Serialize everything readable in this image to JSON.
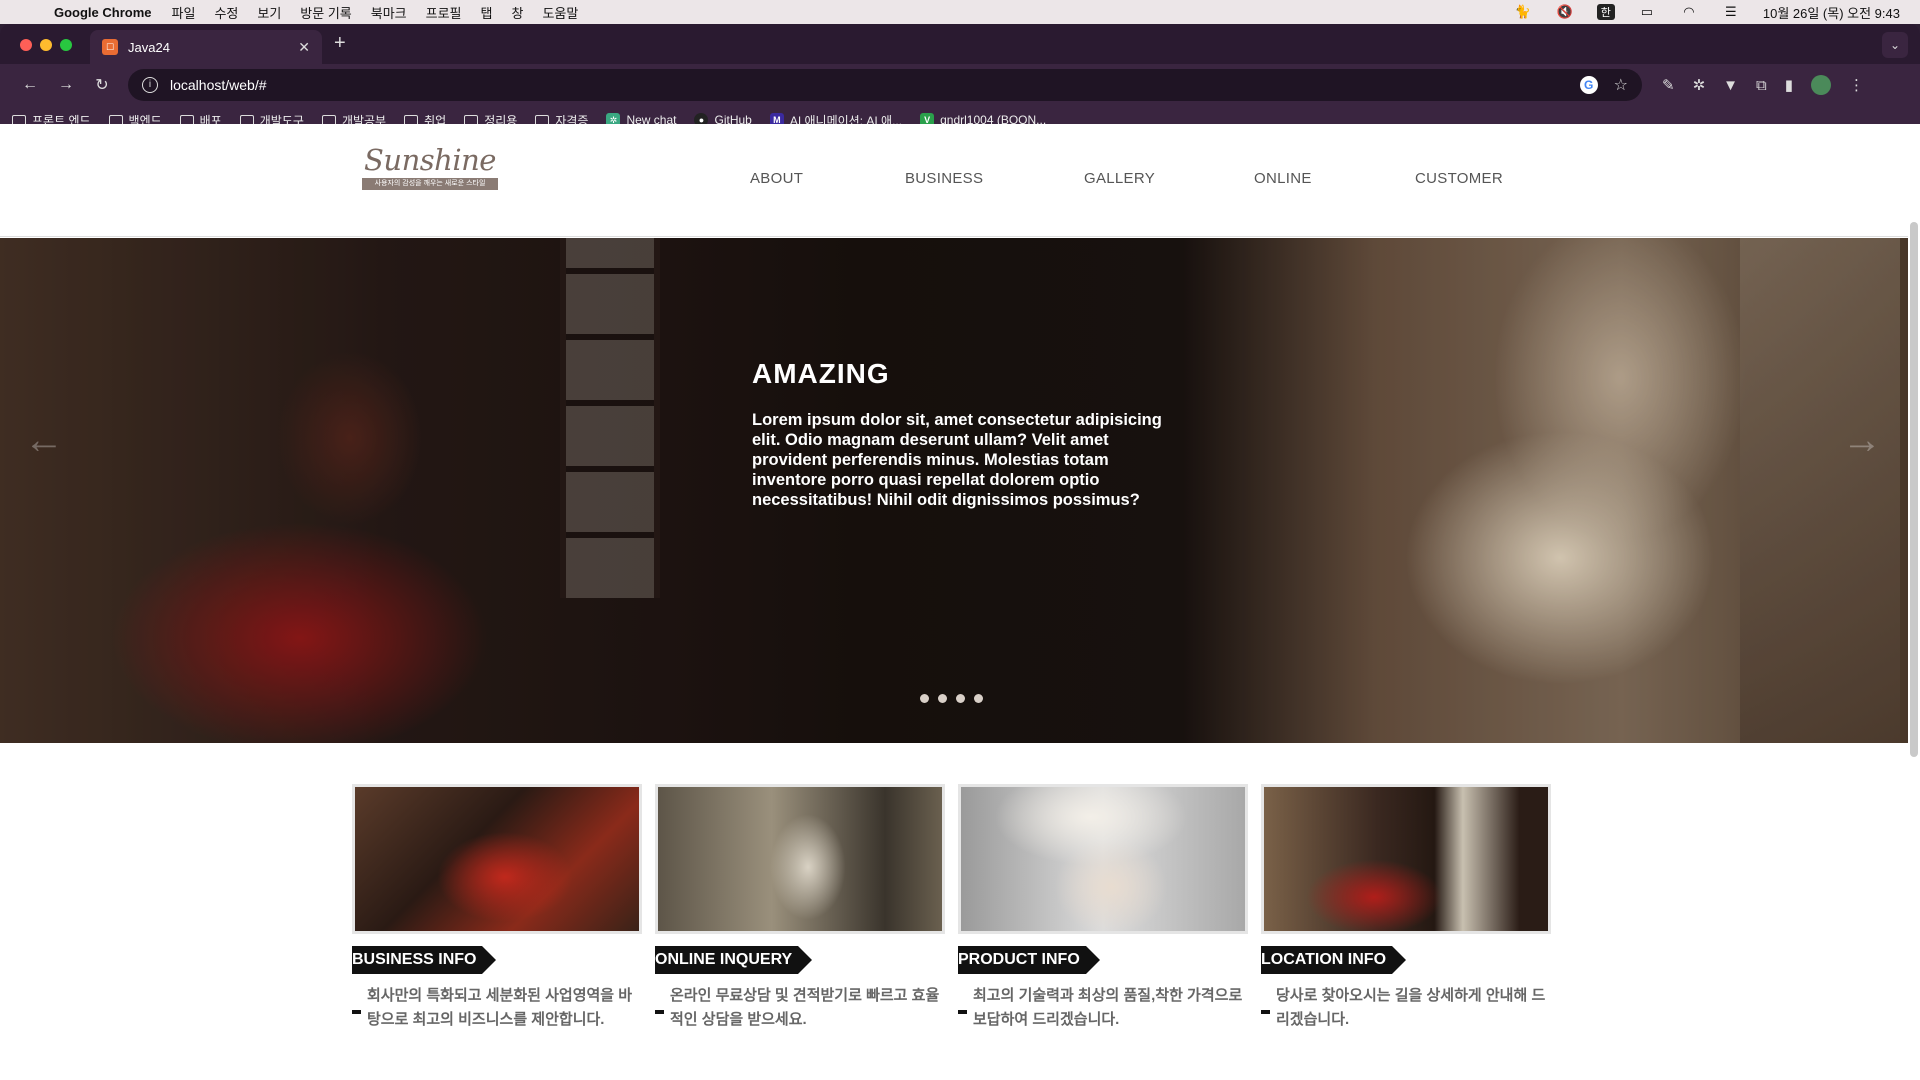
{
  "menubar": {
    "app": "Google Chrome",
    "items": [
      "파일",
      "수정",
      "보기",
      "방문 기록",
      "북마크",
      "프로필",
      "탭",
      "창",
      "도움말"
    ],
    "input_badge": "한",
    "clock": "10월 26일 (목) 오전 9:43"
  },
  "browser": {
    "tab_title": "Java24",
    "url": "localhost/web/#",
    "bookmarks": [
      {
        "label": "프론트 엔드",
        "icon": "folder-icon"
      },
      {
        "label": "백엔드",
        "icon": "folder-icon"
      },
      {
        "label": "배포",
        "icon": "folder-icon"
      },
      {
        "label": "개발도구",
        "icon": "folder-icon"
      },
      {
        "label": "개발공부",
        "icon": "folder-icon"
      },
      {
        "label": "취업",
        "icon": "folder-icon"
      },
      {
        "label": "정리용",
        "icon": "folder-icon"
      },
      {
        "label": "자격증",
        "icon": "folder-icon"
      },
      {
        "label": "New chat",
        "icon": "openai-icon"
      },
      {
        "label": "GitHub",
        "icon": "github-icon"
      },
      {
        "label": "AI 애니메이션: AI 애...",
        "icon": "m-icon"
      },
      {
        "label": "qndrl1004 (BOON...",
        "icon": "v-icon"
      }
    ]
  },
  "site": {
    "logo_text": "Sunshine",
    "logo_tagline": "사용자의 감성을 깨우는 새로운 스타일",
    "nav": [
      "ABOUT",
      "BUSINESS",
      "GALLERY",
      "ONLINE",
      "CUSTOMER"
    ],
    "hero": {
      "headline": "AMAZING",
      "copy": "Lorem ipsum dolor sit, amet consectetur adipisicing elit. Odio magnam deserunt ullam? Velit amet provident perferendis minus. Molestias totam inventore porro quasi repellat dolorem optio necessitatibus! Nihil odit dignissimos possimus?",
      "slide_count": 4
    },
    "cards": [
      {
        "title": "BUSINESS INFO",
        "desc": "회사만의 특화되고 세분화된 사업영역을 바탕으로 최고의 비즈니스를 제안합니다."
      },
      {
        "title": "ONLINE INQUERY",
        "desc": "온라인 무료상담 및 견적받기로 빠르고 효율적인 상담을 받으세요."
      },
      {
        "title": "PRODUCT INFO",
        "desc": "최고의 기술력과 최상의 품질,착한 가격으로 보답하여 드리겠습니다."
      },
      {
        "title": "LOCATION INFO",
        "desc": "당사로 찾아오시는 길을 상세하게 안내해 드리겠습니다."
      }
    ]
  },
  "colors": {
    "browser_frame": "#3a2540",
    "label_bg": "#111111",
    "nav_text": "#555555"
  }
}
